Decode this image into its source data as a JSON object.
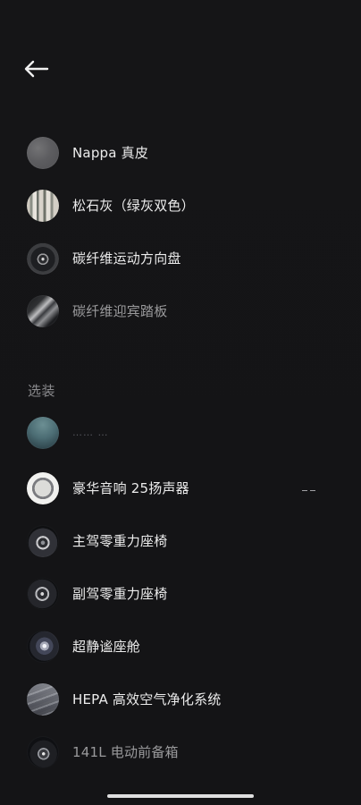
{
  "header": {
    "back_label": ""
  },
  "standard_items": [
    {
      "label": "Nappa 真皮",
      "thumb": "grey-swatch-icon"
    },
    {
      "label": "松石灰（绿灰双色）",
      "thumb": "striped-swatch-icon"
    },
    {
      "label": "碳纤维运动方向盘",
      "thumb": "steering-wheel-icon"
    },
    {
      "label": "碳纤维迎宾踏板",
      "thumb": "door-sill-icon"
    }
  ],
  "section_title": "选装",
  "optional_items": [
    {
      "label": "…… …",
      "thumb": "helmet-icon"
    },
    {
      "label": "豪华音响 25扬声器",
      "thumb": "speaker-icon"
    },
    {
      "label": "主驾零重力座椅",
      "thumb": "driver-seat-icon"
    },
    {
      "label": "副驾零重力座椅",
      "thumb": "passenger-seat-icon"
    },
    {
      "label": "超静谧座舱",
      "thumb": "quiet-cabin-icon"
    },
    {
      "label": "HEPA 高效空气净化系统",
      "thumb": "hepa-filter-icon"
    },
    {
      "label": "141L 电动前备箱",
      "thumb": "frunk-icon"
    }
  ],
  "colors": {
    "background": "#141416",
    "text_primary": "#ececec",
    "text_secondary": "#8b8b8e"
  }
}
